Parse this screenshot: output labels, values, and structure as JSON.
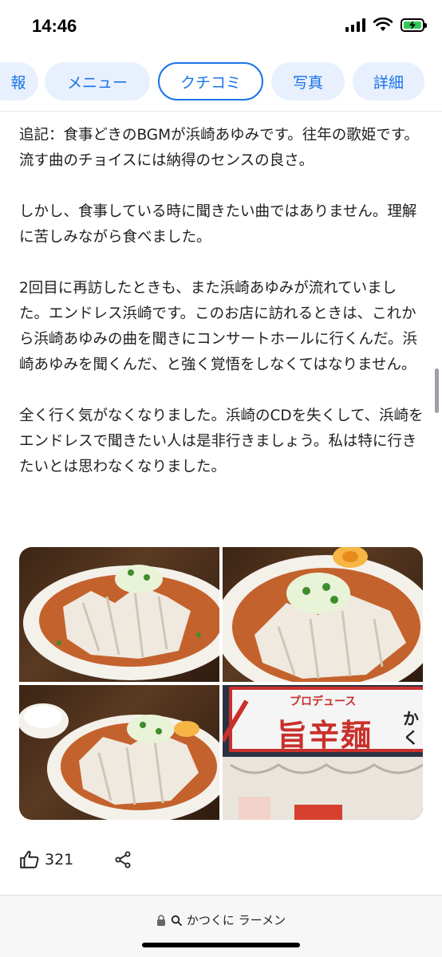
{
  "status": {
    "time": "14:46",
    "icons": [
      "cellular-signal-icon",
      "wifi-icon",
      "battery-charging-icon"
    ]
  },
  "tabs": [
    {
      "label": "報"
    },
    {
      "label": "メニュー"
    },
    {
      "label": "クチコミ",
      "active": true
    },
    {
      "label": "写真"
    },
    {
      "label": "詳細"
    }
  ],
  "review": {
    "paragraphs": [
      "追記：食事どきのBGMが浜崎あゆみです。往年の歌姫です。流す曲のチョイスには納得のセンスの良さ。",
      "しかし、食事している時に聞きたい曲ではありません。理解に苦しみながら食べました。",
      "2回目に再訪したときも、また浜崎あゆみが流れていました。エンドレス浜崎です。このお店に訪れるときは、これから浜崎あゆみの曲を聞きにコンサートホールに行くんだ。浜崎あゆみを聞くんだ、と強く覚悟をしなくてはなりません。",
      "全く行く気がなくなりました。浜崎のCDを失くして、浜崎をエンドレスで聞きたい人は是非行きましょう。私は特に行きたいとは思わなくなりました。"
    ]
  },
  "photos": {
    "storefront_sign": "旨辛麺",
    "storefront_sub": "プロデュース",
    "storefront_side": "かく"
  },
  "actions": {
    "like_count": "321"
  },
  "browser": {
    "url_text": "かつくに ラーメン"
  },
  "colors": {
    "accent": "#1a73e8",
    "tab_bg": "#e8f0fe"
  }
}
